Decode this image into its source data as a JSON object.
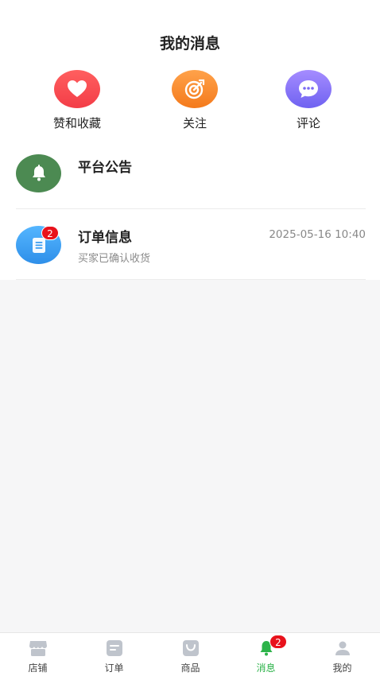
{
  "header": {
    "title": "我的消息"
  },
  "quick_actions": [
    {
      "label": "赞和收藏",
      "icon": "heart-icon",
      "color": "#f33d47"
    },
    {
      "label": "关注",
      "icon": "target-icon",
      "color": "#f47a1c"
    },
    {
      "label": "评论",
      "icon": "chat-bubble-icon",
      "color": "#6f62f1"
    }
  ],
  "messages": [
    {
      "name": "平台公告",
      "icon": "bell-icon",
      "color": "#4c8a52"
    },
    {
      "name": "订单信息",
      "icon": "document-icon",
      "badge": "2",
      "time": "2025-05-16 10:40",
      "preview": "买家已确认收货",
      "color": "#2e8fe9"
    }
  ],
  "tabbar": {
    "items": [
      {
        "label": "店铺",
        "icon": "store-icon"
      },
      {
        "label": "订单",
        "icon": "order-icon"
      },
      {
        "label": "商品",
        "icon": "bag-icon"
      },
      {
        "label": "消息",
        "icon": "bell-icon",
        "badge": "2",
        "active": true,
        "color": "#2db34a"
      },
      {
        "label": "我的",
        "icon": "person-icon"
      }
    ]
  }
}
